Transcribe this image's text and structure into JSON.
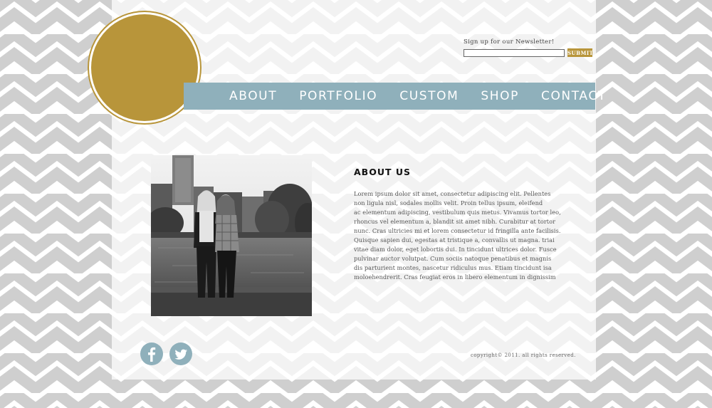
{
  "newsletter": {
    "label": "Sign up for our Newsletter!",
    "input_value": "",
    "submit_label": "SUBMIT"
  },
  "nav": {
    "items": [
      "ABOUT",
      "PORTFOLIO",
      "CUSTOM",
      "SHOP",
      "CONTACT"
    ]
  },
  "about": {
    "title": "ABOUT US",
    "lines": [
      "Lorem ipsum dolor sit amet, consectetur adipiscing elit. Pellentes",
      "non ligula nisl, sodales mollis velit. Proin tellus ipsum, eleifend",
      "ac elementum adipiscing, vestibulum quis metus. Vivamus tortor leo,",
      "rhoncus vel elementum a, blandit sit amet nibh. Curabitur at tortor",
      "nunc. Cras ultricies mi et lorem consectetur id fringilla ante facilisis.",
      "Quisque sapien dui, egestas at tristique a, convallis ut magna. triai",
      "vitae diam dolor, eget lobortis dui. In tincidunt ultrices dolor. Fusce",
      "pulvinar auctor volutpat. Cum sociis natoque penatibus et magnis",
      "dis parturient montes, nascetur ridiculus mus. Etiam tincidunt isa",
      "moloehendrerit. Cras feugiat eros in libero elementum in dignissim"
    ]
  },
  "social": {
    "facebook_icon": "facebook-icon",
    "twitter_icon": "twitter-icon"
  },
  "footer": {
    "copyright": "copyright© 2011. all rights reserved."
  },
  "colors": {
    "gold": "#b8953a",
    "nav_blue": "#8fb0bb",
    "chevron_gray": "#cfcfcf"
  }
}
